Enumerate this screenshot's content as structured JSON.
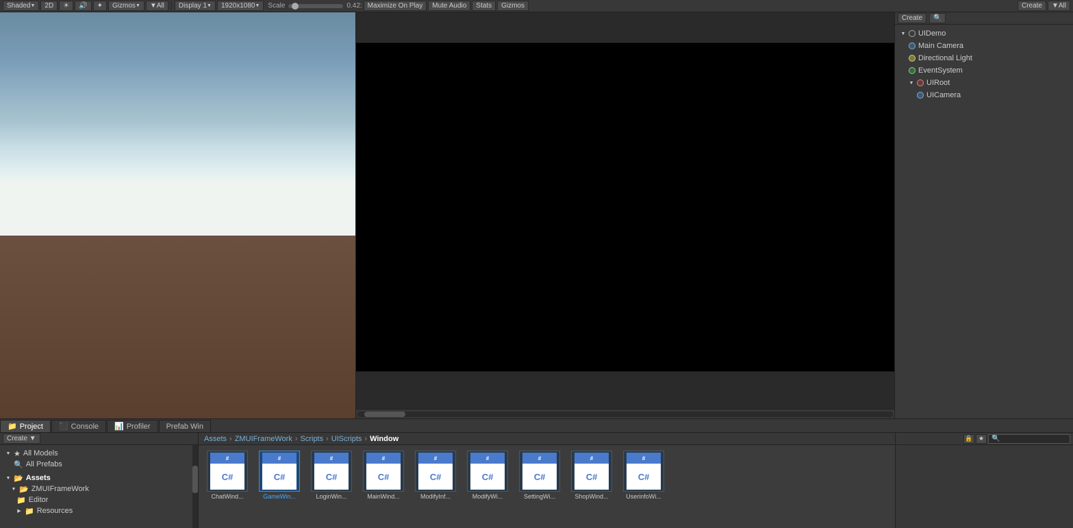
{
  "toolbar": {
    "shaded_label": "Shaded",
    "2d_label": "2D",
    "gizmos_label": "Gizmos",
    "all_label": "▼All",
    "display_label": "Display 1",
    "resolution_label": "1920x1080",
    "scale_label": "Scale",
    "scale_value": "0.42:",
    "maximize_label": "Maximize On Play",
    "mute_label": "Mute Audio",
    "stats_label": "Stats",
    "gizmos2_label": "Gizmos",
    "create_label": "Create",
    "all2_label": "▼All"
  },
  "hierarchy": {
    "title": "UIDemo",
    "items": [
      {
        "label": "Main Camera",
        "type": "camera",
        "indent": 1
      },
      {
        "label": "Directional Light",
        "type": "light",
        "indent": 1
      },
      {
        "label": "EventSystem",
        "type": "event",
        "indent": 1
      },
      {
        "label": "UIRoot",
        "type": "folder",
        "indent": 1
      },
      {
        "label": "UICamera",
        "type": "uitext",
        "indent": 2
      }
    ]
  },
  "bottom": {
    "tabs": [
      {
        "label": "Project",
        "icon": "📁"
      },
      {
        "label": "Console",
        "icon": "⬛"
      },
      {
        "label": "Profiler",
        "icon": "📊"
      },
      {
        "label": "Prefab Win",
        "icon": ""
      }
    ],
    "active_tab": 0,
    "create_btn": "Create ▼",
    "breadcrumb": [
      "Assets",
      "ZMUIFrameWork",
      "Scripts",
      "UIScripts",
      "Window"
    ],
    "file_tree": {
      "items": [
        {
          "label": "Assets",
          "indent": 0,
          "expanded": true
        },
        {
          "label": "ZMUIFrameWork",
          "indent": 1,
          "expanded": true
        },
        {
          "label": "Editor",
          "indent": 2
        },
        {
          "label": "Resources",
          "indent": 2
        }
      ]
    },
    "assets": [
      {
        "label": "ChatWind...",
        "selected": false
      },
      {
        "label": "GameWin...",
        "selected": true
      },
      {
        "label": "LoginWin...",
        "selected": false
      },
      {
        "label": "MainWind...",
        "selected": false
      },
      {
        "label": "ModifyInf...",
        "selected": false
      },
      {
        "label": "ModifyWi...",
        "selected": false
      },
      {
        "label": "SettingWi...",
        "selected": false
      },
      {
        "label": "ShopWind...",
        "selected": false
      },
      {
        "label": "UserinfoWi...",
        "selected": false
      }
    ]
  },
  "status": {
    "right_btn1": "⬛",
    "right_btn2": "⭐",
    "search_placeholder": ""
  }
}
